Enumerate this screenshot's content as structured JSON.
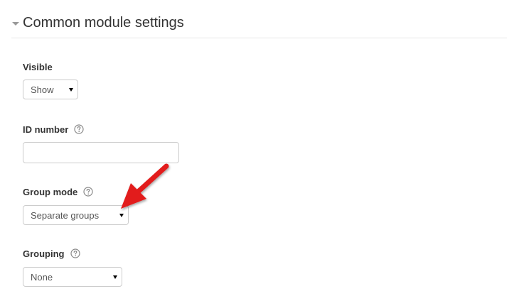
{
  "section": {
    "title": "Common module settings",
    "expanded": true
  },
  "fields": {
    "visible": {
      "label": "Visible",
      "value": "Show"
    },
    "id_number": {
      "label": "ID number",
      "value": ""
    },
    "group_mode": {
      "label": "Group mode",
      "value": "Separate groups"
    },
    "grouping": {
      "label": "Grouping",
      "value": "None"
    }
  },
  "icons": {
    "collapse": "triangle-down-icon",
    "help": "question-circle-icon",
    "dropdown": "caret-down-icon",
    "annotation": "red-arrow-icon"
  },
  "colors": {
    "text": "#333333",
    "border": "#cccccc",
    "divider": "#e5e5e5",
    "annotation": "#e21b1b"
  }
}
